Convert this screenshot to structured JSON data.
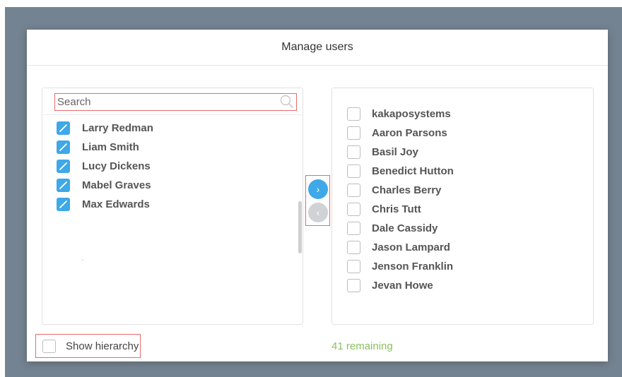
{
  "dialog": {
    "title": "Manage users"
  },
  "search": {
    "placeholder": "Search"
  },
  "selected_users": [
    {
      "name": "Larry Redman",
      "checked": true
    },
    {
      "name": "Liam Smith",
      "checked": true
    },
    {
      "name": "Lucy Dickens",
      "checked": true
    },
    {
      "name": "Mabel Graves",
      "checked": true
    },
    {
      "name": "Max Edwards",
      "checked": true
    }
  ],
  "available_users": [
    {
      "name": "kakaposystems",
      "checked": false
    },
    {
      "name": "Aaron Parsons",
      "checked": false
    },
    {
      "name": "Basil Joy",
      "checked": false
    },
    {
      "name": "Benedict Hutton",
      "checked": false
    },
    {
      "name": "Charles Berry",
      "checked": false
    },
    {
      "name": "Chris Tutt",
      "checked": false
    },
    {
      "name": "Dale Cassidy",
      "checked": false
    },
    {
      "name": "Jason Lampard",
      "checked": false
    },
    {
      "name": "Jenson Franklin",
      "checked": false
    },
    {
      "name": "Jevan Howe",
      "checked": false
    }
  ],
  "transfer": {
    "move_right_icon": "chevron-right-icon",
    "move_left_icon": "chevron-left-icon",
    "move_right_glyph": "›",
    "move_left_glyph": "‹"
  },
  "footer": {
    "show_hierarchy_label": "Show hierarchy",
    "show_hierarchy_checked": false,
    "remaining_text": "41 remaining"
  },
  "colors": {
    "accent": "#3fa8e8",
    "remaining": "#8cc063",
    "highlight_border": "#e8696c",
    "backdrop": "#748391"
  }
}
